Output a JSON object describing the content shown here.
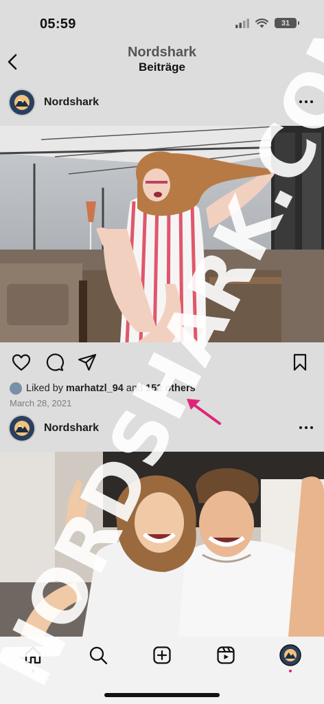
{
  "status_bar": {
    "time": "05:59",
    "battery_level": "31"
  },
  "header": {
    "account_name": "Nordshark",
    "subtitle": "Beiträge"
  },
  "posts": [
    {
      "username": "Nordshark",
      "liked_by_prefix": "Liked by",
      "liked_by_user": "marhatzl_94",
      "liked_by_and": "and",
      "liked_by_others": "152 others",
      "date": "March 28, 2021"
    },
    {
      "username": "Nordshark"
    }
  ],
  "watermark": {
    "text": "NORDSHARK.COM"
  },
  "colors": {
    "background": "#dddddd",
    "accent_pink": "#e0247a",
    "tab_bar": "#f2f2f2",
    "notification_dot": "#e0245e"
  },
  "icons": {
    "back": "chevron-left",
    "more": "ellipsis-horizontal",
    "like": "heart-outline",
    "comment": "speech-bubble",
    "share": "paper-plane",
    "save": "bookmark",
    "home": "home",
    "search": "magnifier",
    "create": "plus-square",
    "reels": "reels",
    "profile": "profile-avatar"
  }
}
